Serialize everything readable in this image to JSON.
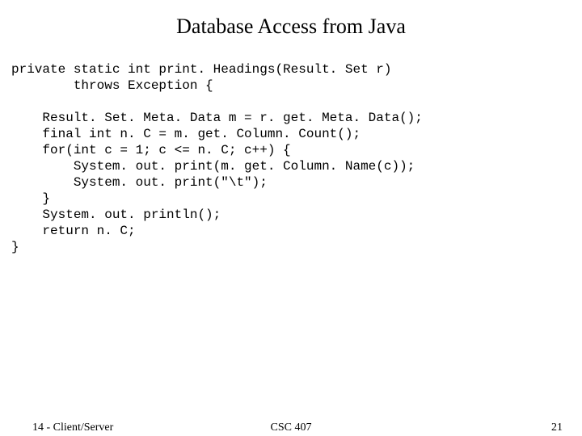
{
  "title": "Database Access from Java",
  "code": "private static int print. Headings(Result. Set r)\n        throws Exception {\n\n    Result. Set. Meta. Data m = r. get. Meta. Data();\n    final int n. C = m. get. Column. Count();\n    for(int c = 1; c <= n. C; c++) {\n        System. out. print(m. get. Column. Name(c));\n        System. out. print(\"\\t\");\n    }\n    System. out. println();\n    return n. C;\n}",
  "footer": {
    "left": "14 - Client/Server",
    "center": "CSC 407",
    "right": "21"
  }
}
